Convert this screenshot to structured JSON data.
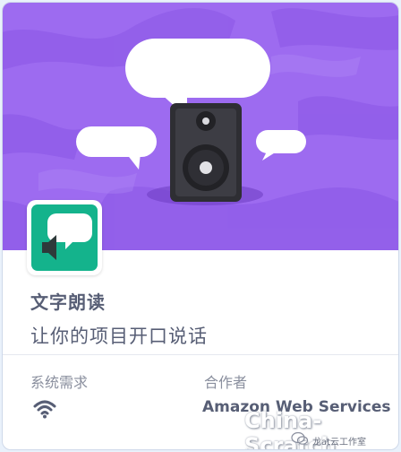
{
  "extension": {
    "title": "文字朗读",
    "description": "让你的项目开口说话"
  },
  "requirements": {
    "label": "系统需求",
    "icon": "wifi-icon"
  },
  "collaborator": {
    "label": "合作者",
    "value": "Amazon Web Services"
  },
  "watermark": {
    "text": "China-Scratch",
    "subtext": "龙at云工作室"
  },
  "colors": {
    "hero_background": "#9d6bf0",
    "icon_background": "#14b38c",
    "text": "#575e75",
    "muted_text": "#8a8f9e"
  }
}
